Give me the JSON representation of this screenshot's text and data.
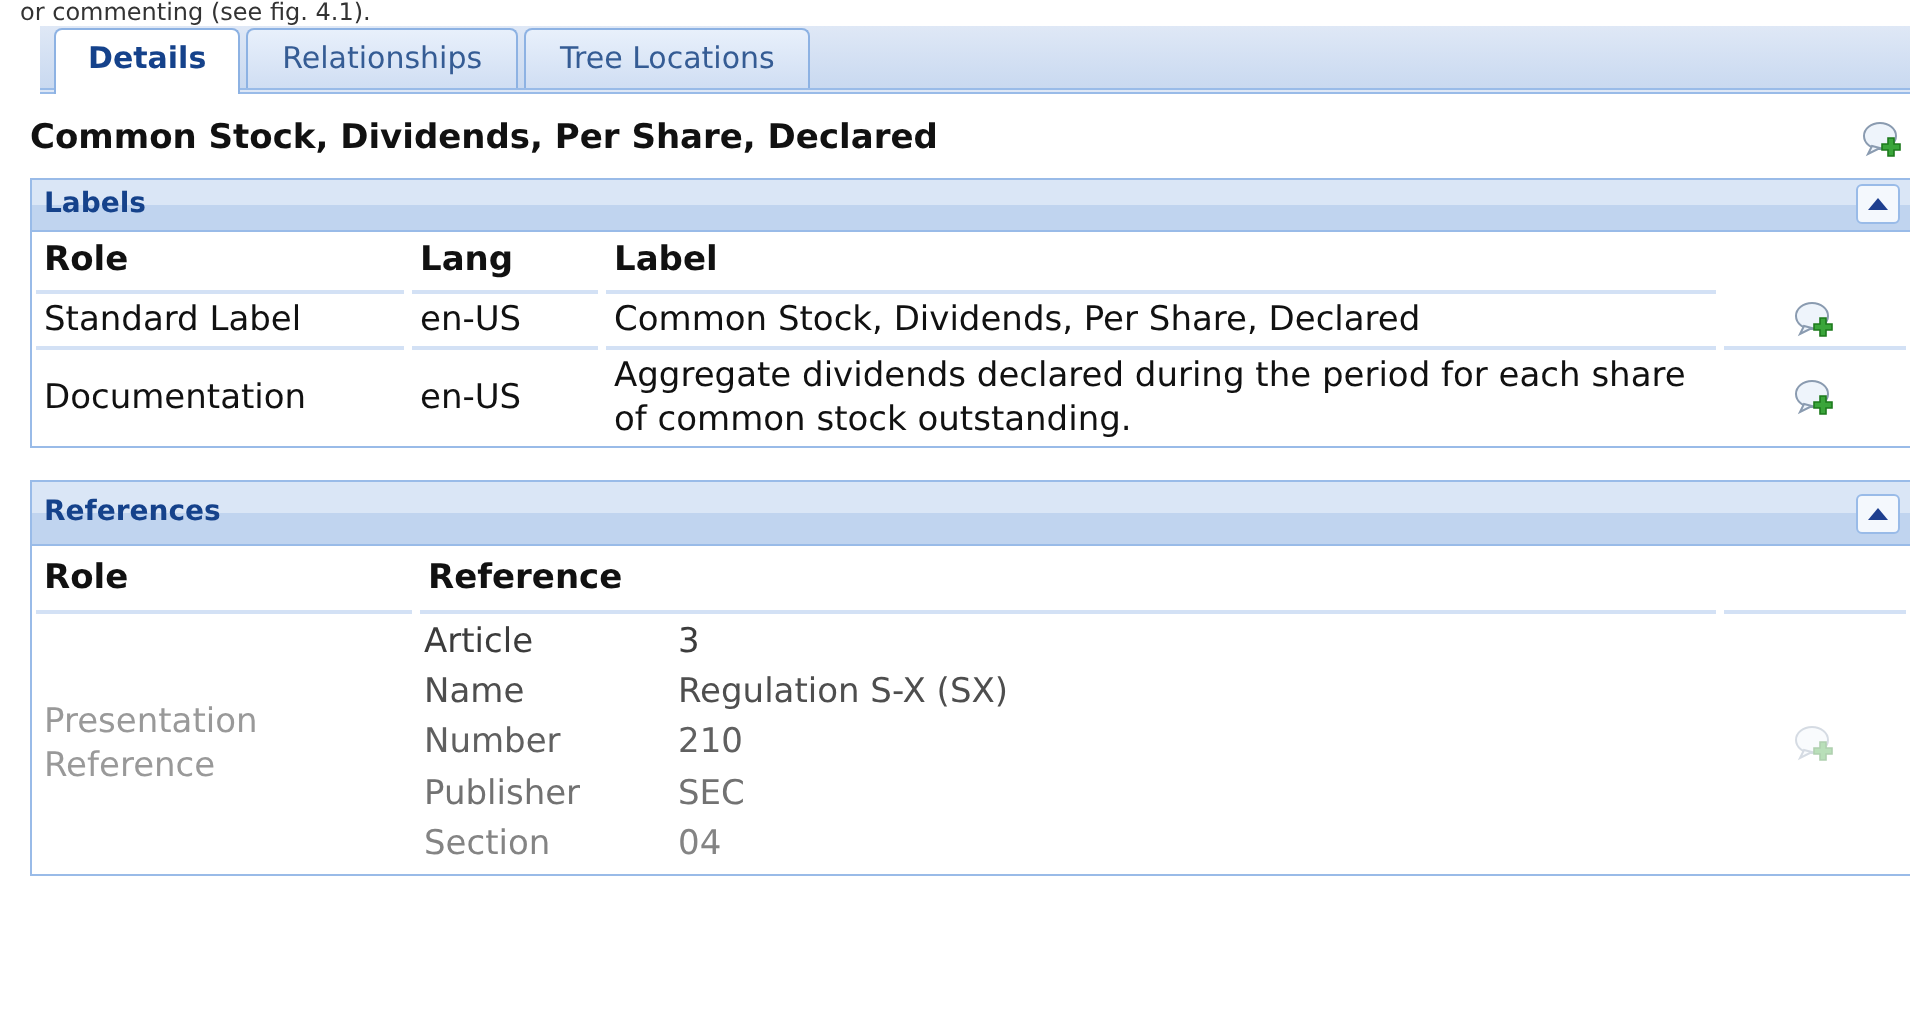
{
  "caption_above": "or commenting (see fig. 4.1).",
  "tabs": [
    {
      "label": "Details",
      "selected": true
    },
    {
      "label": "Relationships",
      "selected": false
    },
    {
      "label": "Tree Locations",
      "selected": false
    }
  ],
  "concept_title": "Common Stock, Dividends, Per Share, Declared",
  "labels_panel": {
    "title": "Labels",
    "expanded": true,
    "columns": [
      "Role",
      "Lang",
      "Label"
    ],
    "rows": [
      {
        "role": "Standard Label",
        "lang": "en-US",
        "label": "Common Stock, Dividends, Per Share, Declared"
      },
      {
        "role": "Documentation",
        "lang": "en-US",
        "label": "Aggregate dividends declared during the period for each share of common stock outstanding."
      }
    ]
  },
  "references_panel": {
    "title": "References",
    "expanded": true,
    "columns": [
      "Role",
      "Reference"
    ],
    "rows": [
      {
        "role": "Presentation Reference",
        "dimmed": true,
        "fields": [
          {
            "key": "Article",
            "value": "3"
          },
          {
            "key": "Name",
            "value": "Regulation S-X (SX)"
          },
          {
            "key": "Number",
            "value": "210"
          },
          {
            "key": "Publisher",
            "value": "SEC"
          },
          {
            "key": "Section",
            "value": "04"
          }
        ]
      }
    ]
  }
}
